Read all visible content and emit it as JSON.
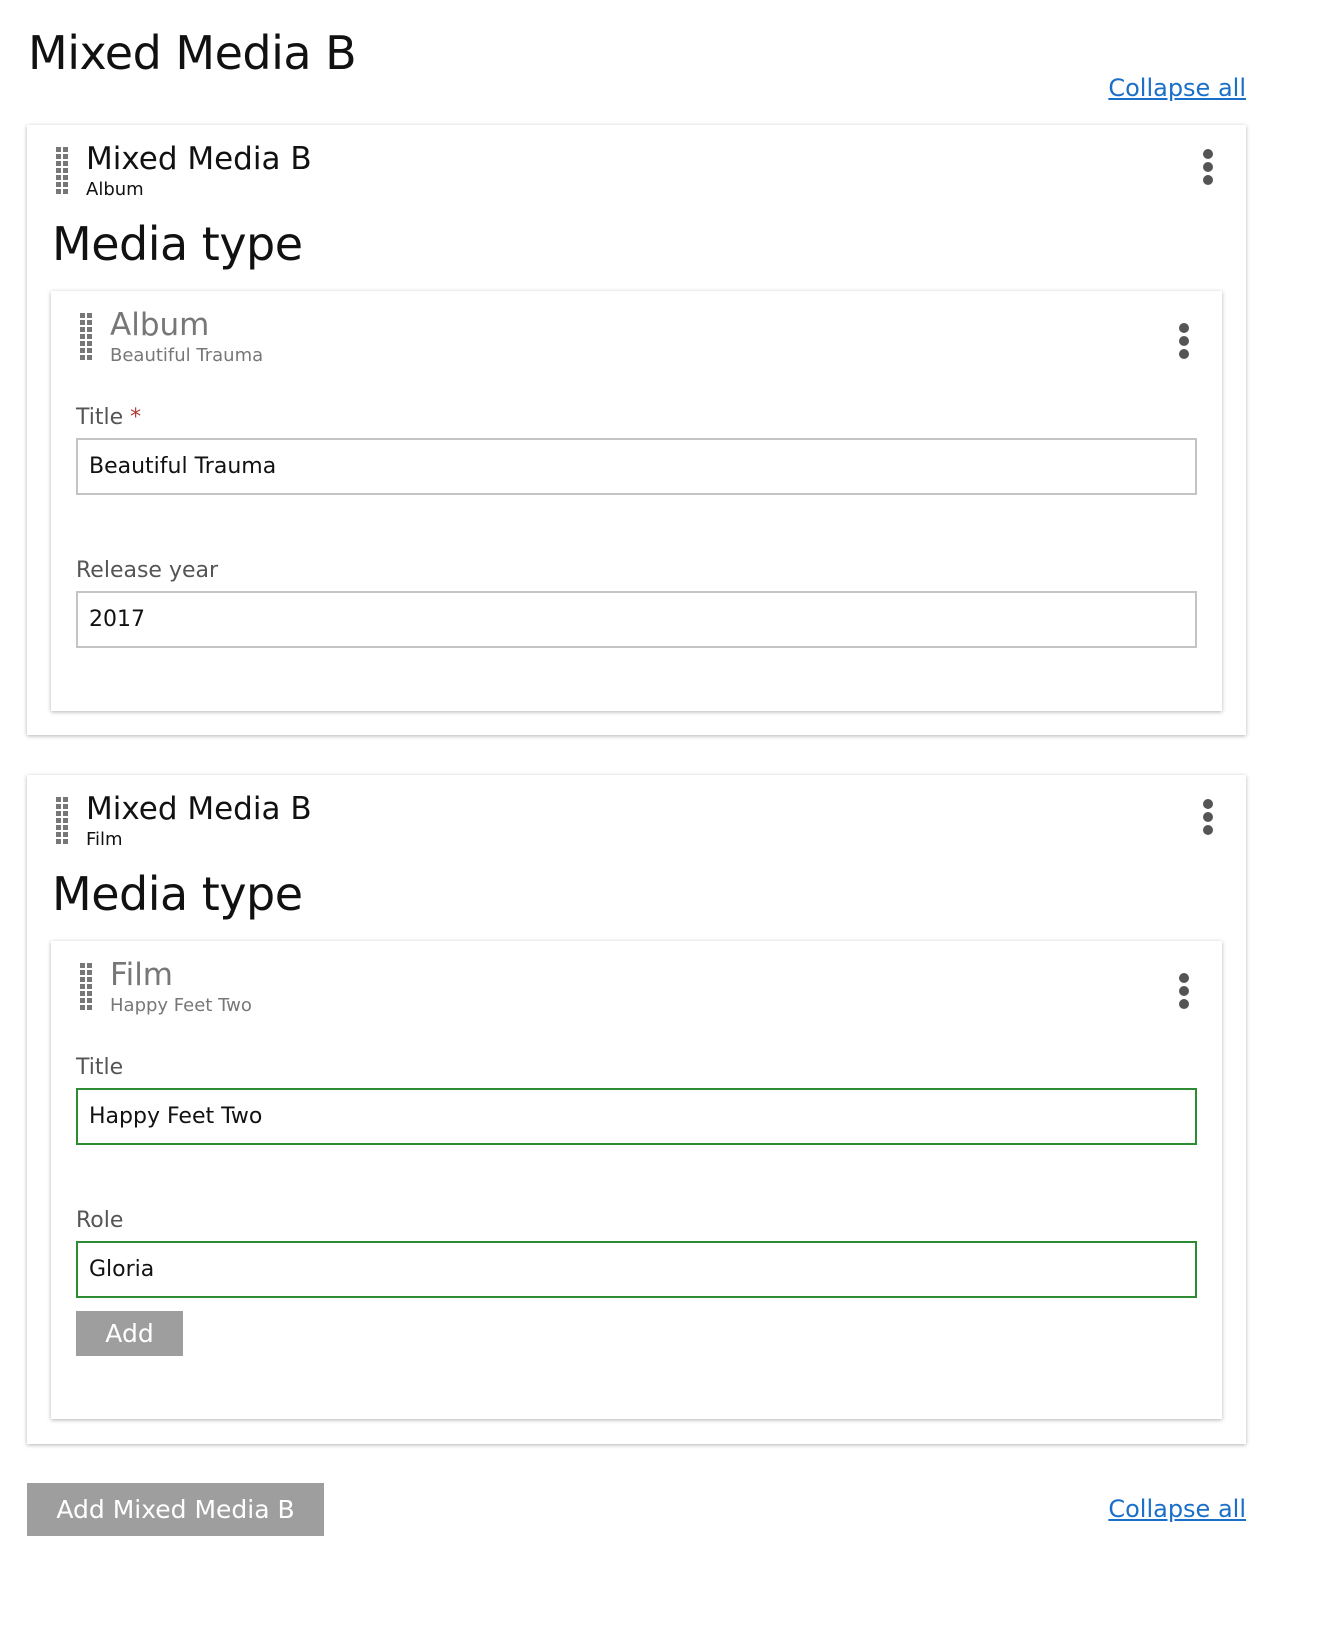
{
  "page": {
    "title": "Mixed Media B",
    "collapse_all_label": "Collapse all",
    "add_button_label": "Add Mixed Media B"
  },
  "items": [
    {
      "title": "Mixed Media B",
      "subtitle": "Album",
      "section_heading": "Media type",
      "nested": {
        "title": "Album",
        "subtitle": "Beautiful Trauma",
        "fields": [
          {
            "label": "Title",
            "required_marker": "*",
            "value": "Beautiful Trauma"
          },
          {
            "label": "Release year",
            "value": "2017"
          }
        ]
      }
    },
    {
      "title": "Mixed Media B",
      "subtitle": "Film",
      "section_heading": "Media type",
      "nested": {
        "title": "Film",
        "subtitle": "Happy Feet Two",
        "fields": [
          {
            "label": "Title",
            "value": "Happy Feet Two"
          },
          {
            "label": "Role",
            "value": "Gloria"
          }
        ],
        "add_label": "Add"
      }
    }
  ],
  "icons": {
    "drag_handle": "drag-handle-icon",
    "more_options": "more-vertical-icon"
  },
  "colors": {
    "link": "#1a6fc9",
    "valid_border": "#2e8b34",
    "required": "#b23b3b",
    "button_bg": "#9e9e9e"
  }
}
